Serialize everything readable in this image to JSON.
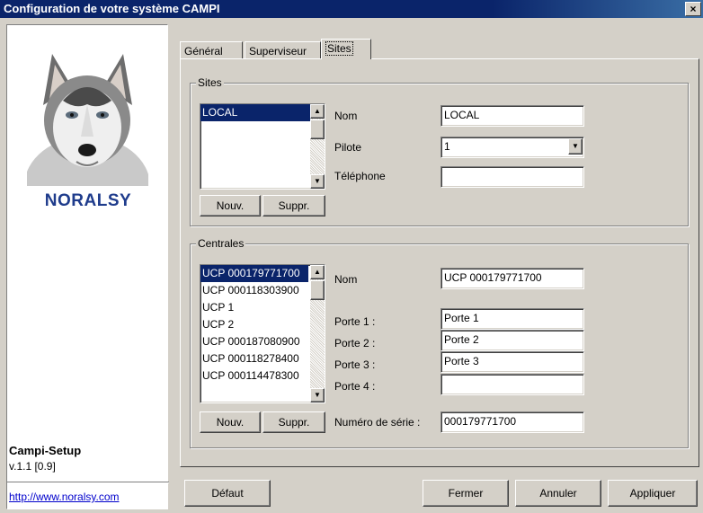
{
  "window": {
    "title": "Configuration de votre système CAMPI",
    "close_glyph": "×"
  },
  "sidebar": {
    "brand": "NORALSY",
    "app_name": "Campi-Setup",
    "version": "v.1.1 [0.9]",
    "link": "http://www.noralsy.com"
  },
  "tabs": [
    {
      "label": "Général"
    },
    {
      "label": "Superviseur"
    },
    {
      "label": "Sites"
    }
  ],
  "sites_group": {
    "legend": "Sites",
    "list": [
      "LOCAL"
    ],
    "new_button": "Nouv.",
    "delete_button": "Suppr.",
    "nom_label": "Nom",
    "nom_value": "LOCAL",
    "pilote_label": "Pilote",
    "pilote_value": "1",
    "telephone_label": "Téléphone",
    "telephone_value": ""
  },
  "centrales_group": {
    "legend": "Centrales",
    "list": [
      "UCP 000179771700",
      "UCP 000118303900",
      "UCP 1",
      "UCP 2",
      "UCP 000187080900",
      "UCP 000118278400",
      "UCP 000114478300"
    ],
    "new_button": "Nouv.",
    "delete_button": "Suppr.",
    "nom_label": "Nom",
    "nom_value": "UCP 000179771700",
    "porte1_label": "Porte 1 :",
    "porte1_value": "Porte 1",
    "porte2_label": "Porte 2 :",
    "porte2_value": "Porte 2",
    "porte3_label": "Porte 3 :",
    "porte3_value": "Porte 3",
    "porte4_label": "Porte 4 :",
    "porte4_value": "",
    "serial_label": "Numéro de série :",
    "serial_value": "000179771700"
  },
  "footer": {
    "default_button": "Défaut",
    "close_button": "Fermer",
    "cancel_button": "Annuler",
    "apply_button": "Appliquer"
  },
  "colors": {
    "title_bar": "#0a246a",
    "selection": "#0a246a",
    "brand": "#1f3c8c",
    "link": "#0000cc"
  }
}
